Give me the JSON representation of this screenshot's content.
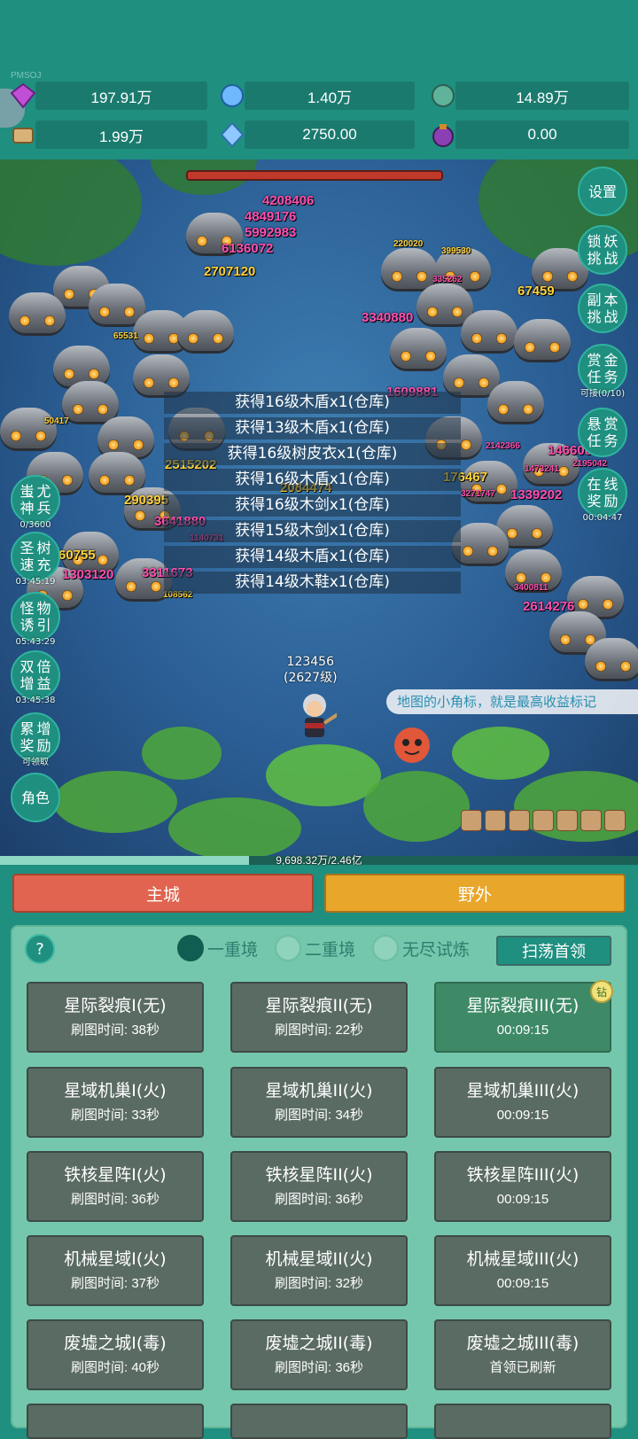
{
  "watermark": "PMSOJ",
  "resources": [
    {
      "icon": "gem-icon",
      "value": "197.91万"
    },
    {
      "icon": "crystal-icon",
      "value": "1.40万"
    },
    {
      "icon": "orb-icon",
      "value": "14.89万"
    },
    {
      "icon": "scroll-icon",
      "value": "1.99万"
    },
    {
      "icon": "diamond-shard-icon",
      "value": "2750.00"
    },
    {
      "icon": "purple-pot-icon",
      "value": "0.00"
    }
  ],
  "damage_numbers": [
    "4208406",
    "4849176",
    "5992983",
    "6136072",
    "2707120",
    "220020",
    "399530",
    "335262",
    "67459",
    "3340880",
    "1609881",
    "2142366",
    "146608",
    "1473241",
    "2195042",
    "176467",
    "3271747",
    "1339202",
    "1303120",
    "2084474",
    "2515202",
    "290395",
    "3641880",
    "3311673",
    "60755",
    "1140731",
    "108562",
    "3400811",
    "2614276",
    "50417",
    "65531"
  ],
  "loot_log": [
    "获得16级木盾x1(仓库)",
    "获得13级木盾x1(仓库)",
    "获得16级树皮衣x1(仓库)",
    "获得16级木盾x1(仓库)",
    "获得16级木剑x1(仓库)",
    "获得15级木剑x1(仓库)",
    "获得14级木盾x1(仓库)",
    "获得14级木鞋x1(仓库)"
  ],
  "right_buttons": {
    "settings": "设置",
    "lock_demon": [
      "锁",
      "妖",
      "挑",
      "战"
    ],
    "dungeon": [
      "副",
      "本",
      "挑",
      "战"
    ],
    "bounty_task": [
      "赏",
      "金",
      "任",
      "务"
    ],
    "bounty_task_sub": "可接(0/10)",
    "reward_task": [
      "悬",
      "赏",
      "任",
      "务"
    ],
    "online_reward": [
      "在",
      "线",
      "奖",
      "励"
    ],
    "online_reward_sub": "00:04:47"
  },
  "left_buttons": {
    "chiyou": [
      "蚩",
      "尤",
      "神",
      "兵"
    ],
    "chiyou_sub": "0/3600",
    "tree_boost": [
      "圣",
      "树",
      "速",
      "充"
    ],
    "tree_boost_sub": "03:45:19",
    "monster_lure": [
      "怪",
      "物",
      "诱",
      "引"
    ],
    "monster_lure_sub": "05:43:29",
    "double_gain": [
      "双",
      "倍",
      "增",
      "益"
    ],
    "double_gain_sub": "03:45:38",
    "accum_reward": [
      "累",
      "增",
      "奖",
      "励"
    ],
    "accum_reward_sub": "可领取",
    "character": "角色"
  },
  "hero": {
    "name": "123456",
    "level": "(2627级)"
  },
  "notice": "地图的小角标，就是最高收益标记",
  "xp_text": "9,698.32万/2.46亿",
  "xp_fraction": 0.39,
  "tabs": {
    "main_city": "主城",
    "wild": "野外"
  },
  "help": "?",
  "realms": [
    {
      "label": "一重境",
      "selected": true
    },
    {
      "label": "二重境",
      "selected": false
    },
    {
      "label": "无尽试炼",
      "selected": false
    }
  ],
  "sweep_button": "扫荡首领",
  "badge": "钻",
  "maps": [
    {
      "title": "星际裂痕I(无)",
      "sub": "刷图时间: 38秒"
    },
    {
      "title": "星际裂痕II(无)",
      "sub": "刷图时间: 22秒"
    },
    {
      "title": "星际裂痕III(无)",
      "sub": "00:09:15"
    },
    {
      "title": "星域机巢I(火)",
      "sub": "刷图时间: 33秒"
    },
    {
      "title": "星域机巢II(火)",
      "sub": "刷图时间: 34秒"
    },
    {
      "title": "星域机巢III(火)",
      "sub": "00:09:15"
    },
    {
      "title": "铁核星阵I(火)",
      "sub": "刷图时间: 36秒"
    },
    {
      "title": "铁核星阵II(火)",
      "sub": "刷图时间: 36秒"
    },
    {
      "title": "铁核星阵III(火)",
      "sub": "00:09:15"
    },
    {
      "title": "机械星域I(火)",
      "sub": "刷图时间: 37秒"
    },
    {
      "title": "机械星域II(火)",
      "sub": "刷图时间: 32秒"
    },
    {
      "title": "机械星域III(火)",
      "sub": "00:09:15"
    },
    {
      "title": "废墟之城I(毒)",
      "sub": "刷图时间: 40秒"
    },
    {
      "title": "废墟之城II(毒)",
      "sub": "刷图时间: 36秒"
    },
    {
      "title": "废墟之城III(毒)",
      "sub": "首领已刷新"
    }
  ]
}
